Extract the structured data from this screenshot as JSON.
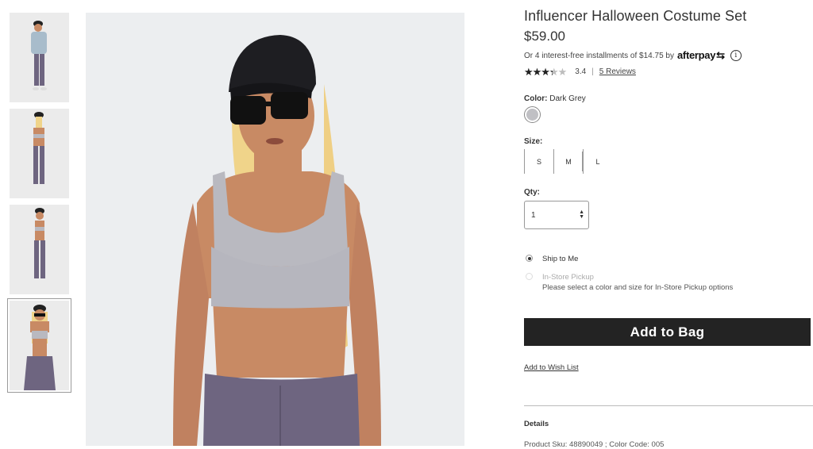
{
  "gallery": {
    "thumbnails": [
      {
        "view": "front-jacket"
      },
      {
        "view": "back"
      },
      {
        "view": "side"
      },
      {
        "view": "front-close",
        "selected": true
      }
    ]
  },
  "product": {
    "title": "Influencer Halloween Costume Set",
    "price": "$59.00",
    "afterpay": {
      "text": "Or 4 interest-free installments of $14.75 by",
      "brand": "afterpay",
      "brand_mark": "⇆"
    },
    "rating": {
      "value": 3.4,
      "value_label": "3.4",
      "separator": "|",
      "reviews_label": "5 Reviews",
      "stars": "★★★★★"
    },
    "color": {
      "label": "Color:",
      "value": "Dark Grey",
      "swatch": "#c0c0c4"
    },
    "size": {
      "label": "Size:",
      "options": [
        "S",
        "M",
        "L"
      ]
    },
    "qty": {
      "label": "Qty:",
      "value": "1",
      "spinner": "▲\n▼"
    },
    "shipping": {
      "ship_label": "Ship to Me",
      "pickup_label": "In-Store Pickup",
      "pickup_note": "Please select a color and size for In-Store Pickup options"
    },
    "add_to_bag": "Add to Bag",
    "wishlist": "Add to Wish List",
    "details_heading": "Details",
    "sku_line": "Product Sku: 48890049 ; Color Code: 005"
  },
  "colors": {
    "button_bg": "#232323",
    "accent_text": "#333333",
    "hair": "#f0d48a",
    "top": "#b9b9c0",
    "pants": "#6e6580",
    "skin": "#c88a64"
  }
}
